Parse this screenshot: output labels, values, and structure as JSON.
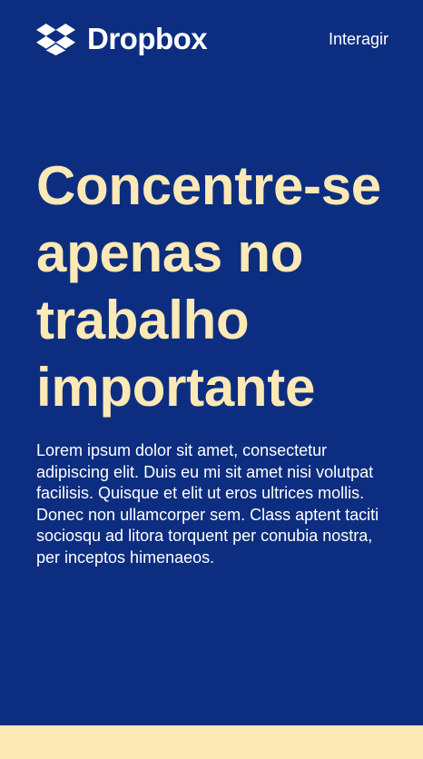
{
  "header": {
    "brand_name": "Dropbox",
    "logo_icon": "dropbox-logo-icon",
    "nav_link": "Interagir"
  },
  "hero": {
    "headline": "Concentre-se apenas no trabalho importante",
    "body": "Lorem ipsum dolor sit amet, consectetur adipiscing elit. Duis eu mi sit amet nisi volutpat facilisis. Quisque et elit ut eros ultrices mollis. Donec non ullamcorper sem. Class aptent taciti sociosqu ad litora torquent per conubia nostra, per inceptos himenaeos."
  },
  "colors": {
    "background": "#0d2e80",
    "accent_cream": "#fde9b5",
    "text_white": "#ffffff"
  }
}
